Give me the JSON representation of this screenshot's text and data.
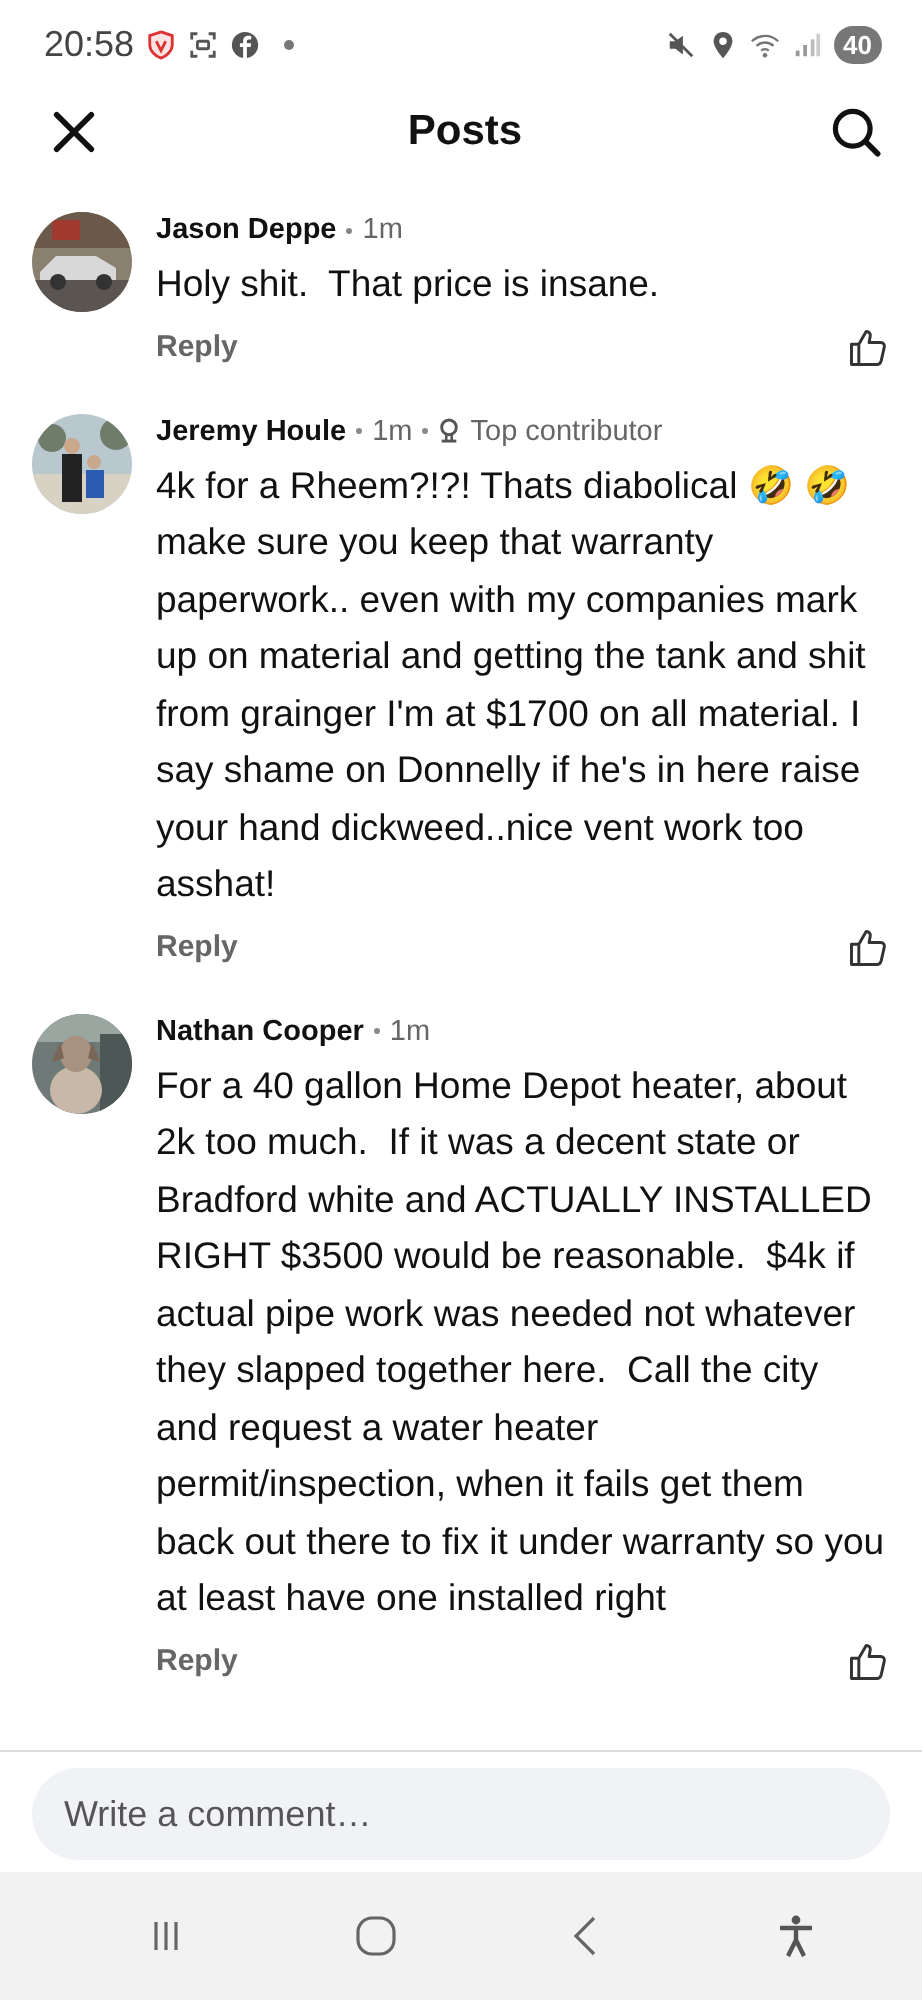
{
  "status_bar": {
    "time": "20:58",
    "battery": "40"
  },
  "header": {
    "title": "Posts"
  },
  "comments": [
    {
      "author": "Jason Deppe",
      "time": "1m",
      "text": "Holy shit.  That price is insane.",
      "reply": "Reply"
    },
    {
      "author": "Jeremy Houle",
      "time": "1m",
      "badge": "Top contributor",
      "text": "4k for a Rheem?!?! Thats diabolical 🤣 🤣 make sure you keep that warranty paperwork.. even with my companies mark up on material and getting the tank and shit from grainger I'm at $1700 on all material. I say shame on Donnelly if he's in here raise your hand dickweed..nice vent work too asshat!",
      "reply": "Reply"
    },
    {
      "author": "Nathan Cooper",
      "time": "1m",
      "text": "For a 40 gallon Home Depot heater, about 2k too much.  If it was a decent state or Bradford white and ACTUALLY INSTALLED RIGHT $3500 would be reasonable.  $4k if actual pipe work was needed not whatever they slapped together here.  Call the city and request a water heater permit/inspection, when it fails get them back out there to fix it under warranty so you at least have one installed right",
      "reply": "Reply"
    }
  ],
  "composer": {
    "placeholder": "Write a comment…"
  }
}
